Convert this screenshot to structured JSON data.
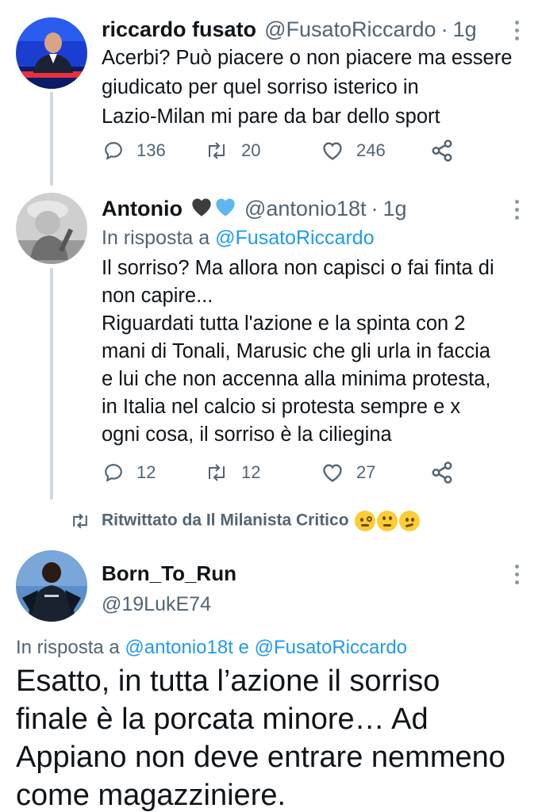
{
  "tweets": [
    {
      "name": "riccardo fusato",
      "handle": "@FusatoRiccardo",
      "time": "1g",
      "body": [
        "Acerbi? Può piacere o non piacere ma essere",
        "giudicato per quel sorriso isterico in",
        "Lazio-Milan mi pare da bar dello sport"
      ],
      "replies": "136",
      "retweets": "20",
      "likes": "246"
    },
    {
      "name": "Antonio",
      "handle": "@antonio18t",
      "time": "1g",
      "replying_prefix": "In risposta a",
      "replying_to": "@FusatoRiccardo",
      "body": [
        "Il sorriso? Ma allora non capisci o fai finta di",
        "non capire...",
        "Riguardati tutta l'azione e la spinta con 2",
        "mani di Tonali, Marusic che gli urla in faccia",
        "e lui che non accenna alla minima protesta,",
        "in Italia nel calcio si protesta sempre e  x",
        "ogni cosa, il sorriso è la ciliegina"
      ],
      "replies": "12",
      "retweets": "12",
      "likes": "27"
    },
    {
      "retweeted_by": "Ritwittato da Il Milanista Critico",
      "name": "Born_To_Run",
      "handle": "@19LukE74",
      "replying_prefix": "In risposta a",
      "replying_to_1": "@antonio18t",
      "replying_and": "e",
      "replying_to_2": "@FusatoRiccardo",
      "body": [
        "Esatto, in tutta l’azione il sorriso",
        "finale è la porcata minore… Ad",
        "Appiano non deve entrare nemmeno",
        "come magazziniere."
      ]
    }
  ],
  "colors": {
    "accent": "#1d9bf0",
    "secondary_text": "#536471",
    "heart": "#3d3d3d",
    "blue_heart": "#5db8f0"
  },
  "icons": {
    "reply": "speech-bubble-icon",
    "retweet": "retweet-arrows-icon",
    "like": "heart-outline-icon",
    "share": "share-nodes-icon",
    "more": "vertical-dots-icon"
  }
}
